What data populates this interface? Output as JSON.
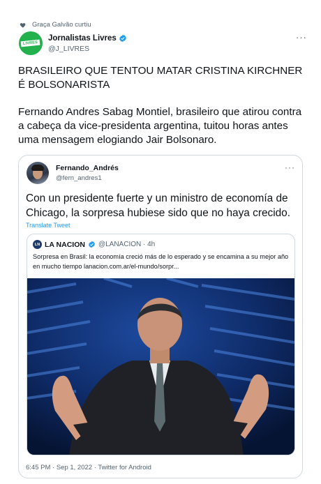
{
  "social_context": {
    "text": "Graça Galvão curtiu",
    "icon": "heart-icon"
  },
  "author": {
    "name": "Jornalistas Livres",
    "handle": "@J_LIVRES",
    "avatar_text": "LIVRES",
    "verified_icon": "verified-badge-icon",
    "brand_color": "#23b14d"
  },
  "tweet": {
    "headline": "BRASILEIRO QUE TENTOU MATAR CRISTINA KIRCHNER É BOLSONARISTA",
    "body": "Fernando Andres Sabag Montiel, brasileiro que atirou contra a cabeça da vice-presidenta argentina, tuitou horas antes uma mensagem elogiando Jair Bolsonaro."
  },
  "quoted_tweet": {
    "author_name": "Fernando_Andrés",
    "author_handle": "@fern_andres1",
    "text": "Con un presidente fuerte y un ministro de economía de Chicago, la sorpresa hubiese sido que no haya crecido.",
    "translate_label": "Translate Tweet",
    "timestamp": "6:45 PM · Sep 1, 2022 · Twitter for Android",
    "nested": {
      "logo_text": "LN",
      "name": "LA NACION",
      "handle": "@LANACION · 4h",
      "text": "Sorpresa en Brasil: la economía creció más de lo esperado y se encamina a su mejor año en mucho tiempo lanacion.com.ar/el-mundo/sorpr...",
      "verified_icon": "verified-badge-icon"
    }
  },
  "colors": {
    "accent": "#1d9bf0",
    "muted": "#536471",
    "border": "#cfd9de"
  }
}
